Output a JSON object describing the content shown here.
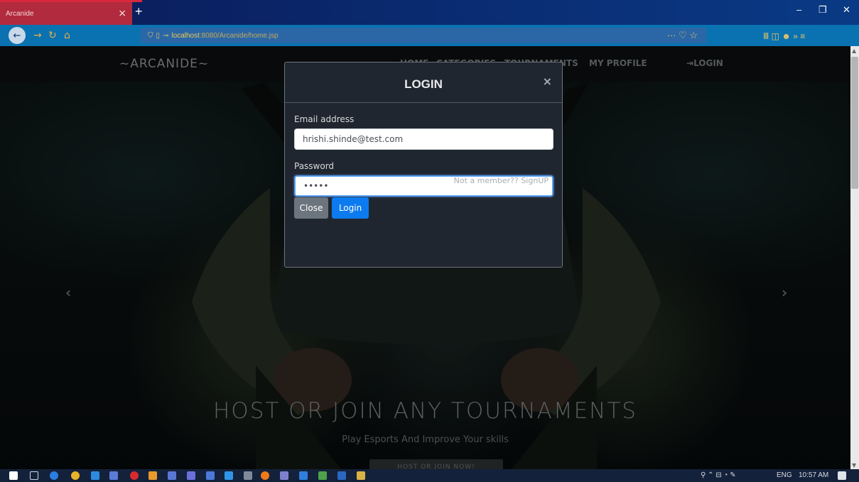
{
  "browser": {
    "tab_title": "Arcanide",
    "tab_close": "×",
    "new_tab": "+",
    "window_controls": {
      "minimize": "–",
      "restore": "❐",
      "close": "✕"
    },
    "url_host": "localhost",
    "url_path": ":8080/Arcanide/home.jsp",
    "url_actions": "··· ♡ ☆",
    "toolbar_right": "Ⅲ ◫ ☻ » ≡"
  },
  "site": {
    "brand": "~ARCANIDE~",
    "nav": {
      "home": "HOME",
      "categories": "CATEGORIES",
      "tournaments": "TOURNAMENTS",
      "profile": "MY PROFILE",
      "login": "LOGIN"
    },
    "hero": {
      "title": "HOST OR JOIN ANY TOURNAMENTS",
      "subtitle": "Play Esports And Improve Your skills",
      "button": "HOST OR JOIN NOW!"
    },
    "carousel": {
      "prev": "‹",
      "next": "›"
    }
  },
  "modal": {
    "title": "LOGIN",
    "close_x": "×",
    "email_label": "Email address",
    "email_value": "hrishi.shinde@test.com",
    "password_label": "Password",
    "password_value": "•••••",
    "signup_text": "Not a member?? SignUP",
    "close_button": "Close",
    "login_button": "Login"
  },
  "taskbar": {
    "tray_lang": "ENG",
    "tray_time": "10:57 AM"
  }
}
